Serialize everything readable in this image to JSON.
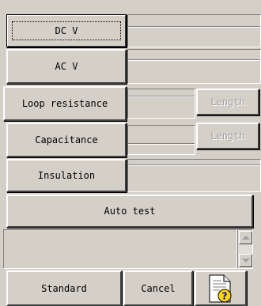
{
  "measurements": {
    "dc_v_label": "DC V",
    "ac_v_label": "AC V",
    "loop_resistance_label": "Loop resistance",
    "capacitance_label": "Capacitance",
    "insulation_label": "Insulation",
    "auto_test_label": "Auto test"
  },
  "length_buttons": {
    "loop_length_label": "Length",
    "capacitance_length_label": "Length"
  },
  "footer": {
    "standard_label": "Standard",
    "cancel_label": "Cancel",
    "help_icon": "document-help-icon"
  },
  "colors": {
    "window_bg": "#d4d0c8",
    "disabled_text": "#a0a0a0",
    "help_badge": "#ffd700"
  }
}
